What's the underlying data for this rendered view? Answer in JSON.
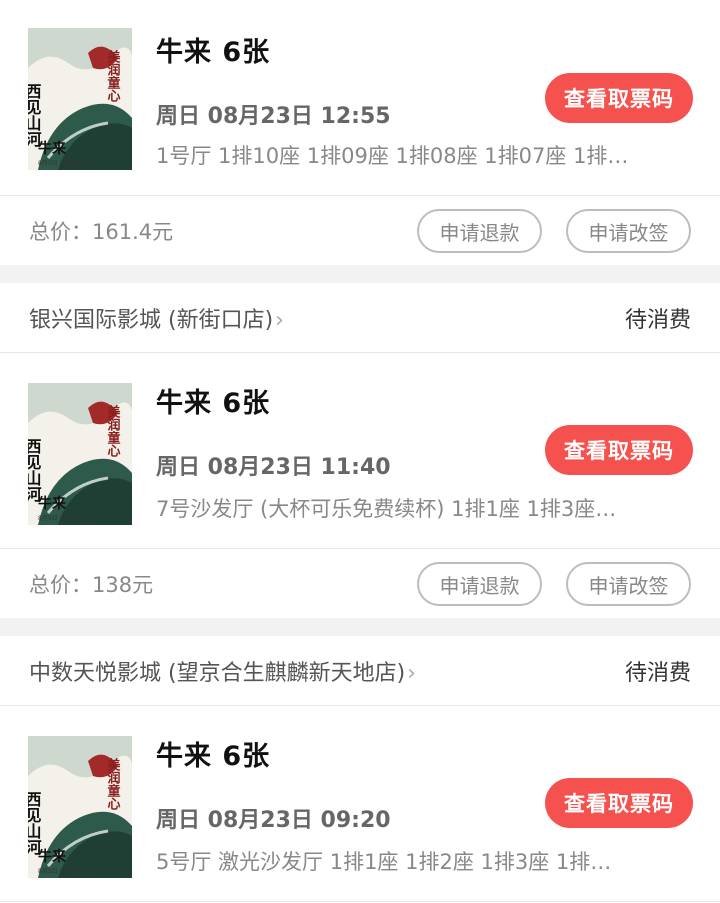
{
  "orders": [
    {
      "cinema": "",
      "status": "",
      "movie_title": "牛来 6张",
      "showtime": "周日 08月23日 12:55",
      "seats": "1号厅 1排10座 1排09座 1排08座 1排07座 1排…",
      "ticket_button": "查看取票码",
      "price_label": "总价：",
      "price": "161.4元",
      "refund_button": "申请退款",
      "change_button": "申请改签"
    },
    {
      "cinema": "银兴国际影城 (新街口店)",
      "status": "待消费",
      "movie_title": "牛来 6张",
      "showtime": "周日 08月23日 11:40",
      "seats": "7号沙发厅 (大杯可乐免费续杯) 1排1座 1排3座…",
      "ticket_button": "查看取票码",
      "price_label": "总价：",
      "price": "138元",
      "refund_button": "申请退款",
      "change_button": "申请改签"
    },
    {
      "cinema": "中数天悦影城 (望京合生麒麟新天地店)",
      "status": "待消费",
      "movie_title": "牛来 6张",
      "showtime": "周日 08月23日 09:20",
      "seats": "5号厅 激光沙发厅 1排1座 1排2座 1排3座 1排…",
      "ticket_button": "查看取票码"
    }
  ],
  "poster": {
    "text_left": "西见山河",
    "text_right": "美润童心",
    "text_title": "牛来",
    "text_small": "8月5日 全国上映"
  },
  "colors": {
    "accent": "#f5524f",
    "background": "#f2f2f2"
  },
  "icons": [
    "chevron-right-icon"
  ]
}
